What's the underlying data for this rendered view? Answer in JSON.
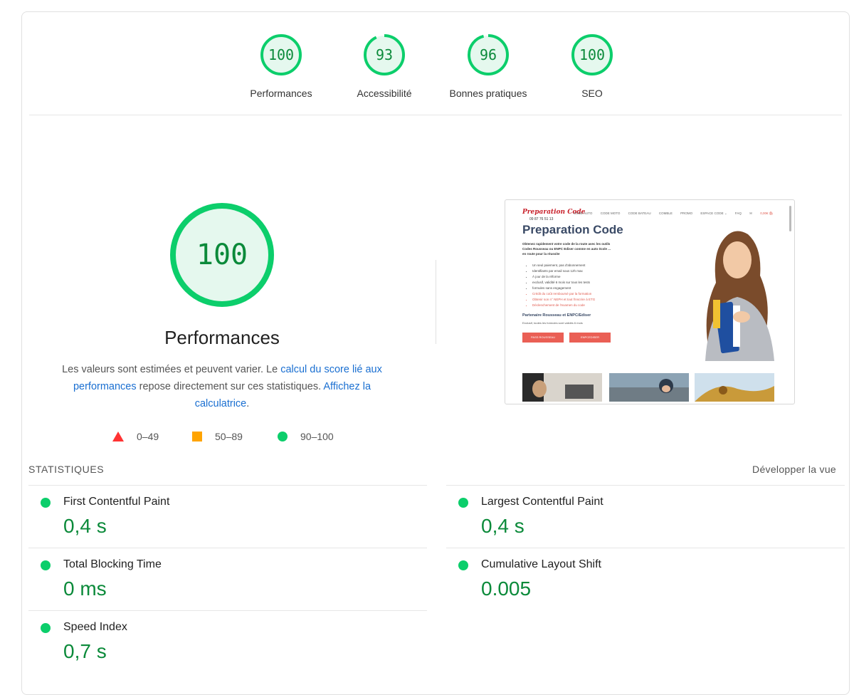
{
  "categories": [
    {
      "score": "100",
      "label": "Performances",
      "fraction": 1.0
    },
    {
      "score": "93",
      "label": "Accessibilité",
      "fraction": 0.93
    },
    {
      "score": "96",
      "label": "Bonnes pratiques",
      "fraction": 0.96
    },
    {
      "score": "100",
      "label": "SEO",
      "fraction": 1.0
    }
  ],
  "main": {
    "score": "100",
    "title": "Performances",
    "desc_pre": "Les valeurs sont estimées et peuvent varier. Le ",
    "desc_link1": "calcul du score lié aux performances",
    "desc_mid": " repose directement sur ces statistiques. ",
    "desc_link2": "Affichez la calculatrice",
    "desc_post": "."
  },
  "legend": {
    "fail": "0–49",
    "average": "50–89",
    "pass": "90–100"
  },
  "thumbnail": {
    "logo": "Preparation Code",
    "phone": "09 87 76 51 13",
    "nav": [
      "CODE AUTO",
      "CODE MOTO",
      "CODE BATEAU",
      "COMBLE",
      "PROMO",
      "ESPACE CODE ⌄",
      "FAQ",
      "✉",
      "0,00€ 🛍"
    ],
    "heading": "Preparation Code",
    "lead": "Obtenez rapidement votre code de la route avec les outils Codes Rousseau ou ENPC Ediser comme en auto école ... en route pour la réussite",
    "bullets": [
      "Un seul paiement, pas d'abonnement",
      "Identifiants par email sous 12h max",
      "À jour de la réforme",
      "exclusif, validité 6 mois sur tous les tests",
      "formules sans engagement"
    ],
    "bullets_red": [
      "Crédit du coût remboursé par la formation",
      "Obtenir son n° NEPH et tout l'inscrire à ETG",
      "Déclenchement de l'examen du code"
    ],
    "subhead": "Partenaire Rousseau et ENPC/Ediser",
    "subtext": "Exclusif, toutes les formules sont validés 6 mois",
    "btn1": "PASS ROUSSEAU",
    "btn2": "ENPCEDISER"
  },
  "stats": {
    "label": "STATISTIQUES",
    "expand": "Développer la vue",
    "metrics": [
      {
        "name": "First Contentful Paint",
        "value": "0,4 s"
      },
      {
        "name": "Largest Contentful Paint",
        "value": "0,4 s"
      },
      {
        "name": "Total Blocking Time",
        "value": "0 ms"
      },
      {
        "name": "Cumulative Layout Shift",
        "value": "0.005"
      },
      {
        "name": "Speed Index",
        "value": "0,7 s"
      }
    ]
  },
  "colors": {
    "pass": "#0cce6b",
    "pass_text": "#0b8a3a",
    "pass_bg": "#e5f8ee",
    "average": "#ffa400",
    "fail": "#ff3333",
    "link": "#1a6fd1"
  }
}
